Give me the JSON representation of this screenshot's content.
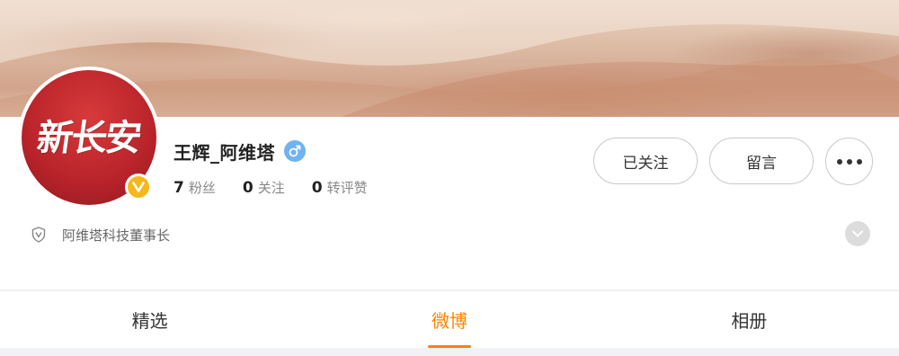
{
  "profile": {
    "avatar_text": "新长安",
    "name": "王辉_阿维塔",
    "gender": "male",
    "description": "阿维塔科技董事长",
    "verified_color": "#f5b81c",
    "gender_color": "#6fb3f0"
  },
  "stats": [
    {
      "value": "7",
      "label": "粉丝"
    },
    {
      "value": "0",
      "label": "关注"
    },
    {
      "value": "0",
      "label": "转评赞"
    }
  ],
  "actions": {
    "follow_label": "已关注",
    "message_label": "留言",
    "more_icon": "more-horizontal-icon"
  },
  "tabs": [
    {
      "label": "精选",
      "active": false
    },
    {
      "label": "微博",
      "active": true
    },
    {
      "label": "相册",
      "active": false
    }
  ],
  "colors": {
    "accent": "#ff8200",
    "avatar_bg": "#b8232a"
  }
}
